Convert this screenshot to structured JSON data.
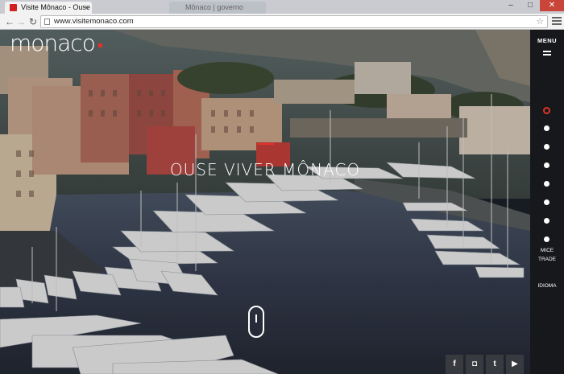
{
  "browser": {
    "active_tab_title": "Visite Mônaco - Ouse Viv",
    "inactive_tab_title": "Mônaco | governo",
    "url": "www.visitemonaco.com",
    "back_icon": "arrow-left",
    "forward_icon": "arrow-right",
    "reload_icon": "reload",
    "star_icon": "star",
    "menu_icon": "hamburger",
    "window_controls": [
      "–",
      "□",
      "✕"
    ]
  },
  "site": {
    "logo": "monaco",
    "hero_title": "OUSE VIVER MÔNACO",
    "sidebar": {
      "menu_label": "MENU",
      "links": [
        "MICE",
        "TRADE"
      ],
      "language_label": "IDIOMA",
      "slide_count": 8,
      "active_slide": 1
    },
    "social": [
      {
        "name": "facebook",
        "glyph": "f"
      },
      {
        "name": "instagram",
        "glyph": "◘"
      },
      {
        "name": "twitter",
        "glyph": "t"
      },
      {
        "name": "youtube",
        "glyph": "▶"
      }
    ],
    "accent_color": "#e3322a"
  }
}
